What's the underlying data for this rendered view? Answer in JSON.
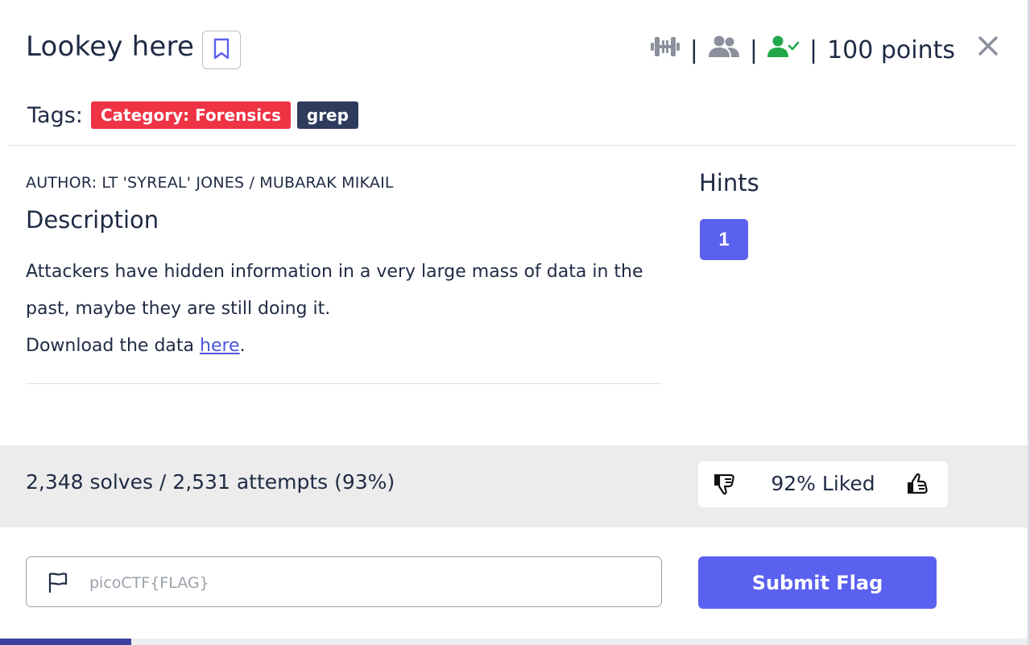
{
  "challenge": {
    "title": "Lookey here",
    "points_text": "100 points",
    "meta_separator": "|",
    "tags_label": "Tags:",
    "tags": [
      "Category: Forensics",
      "grep"
    ],
    "author": "AUTHOR: LT 'SYREAL' JONES / MUBARAK MIKAIL",
    "description_heading": "Description",
    "description_line1": "Attackers have hidden information in a very large mass of data in the past, maybe they are still doing it.",
    "download_prefix": "Download the data ",
    "download_link": "here",
    "download_suffix": "."
  },
  "hints": {
    "heading": "Hints",
    "items": [
      "1"
    ]
  },
  "stats": {
    "solves_text": "2,348 solves / 2,531 attempts (93%)",
    "liked_text": "92% Liked"
  },
  "flag_form": {
    "placeholder": "picoCTF{FLAG}",
    "submit_label": "Submit Flag"
  },
  "icons": {
    "difficulty": "barbell-icon",
    "team": "users-icon",
    "solved": "user-check-icon",
    "close": "close-icon",
    "bookmark": "bookmark-icon",
    "flag": "flag-icon",
    "dislike": "thumbs-down-icon",
    "like": "thumbs-up-icon"
  },
  "colors": {
    "accent": "#5b61ef",
    "tag_category": "#ee3344",
    "tag_dark": "#2f3b5c",
    "solved_green": "#22a84a",
    "icon_gray": "#8a909c"
  }
}
